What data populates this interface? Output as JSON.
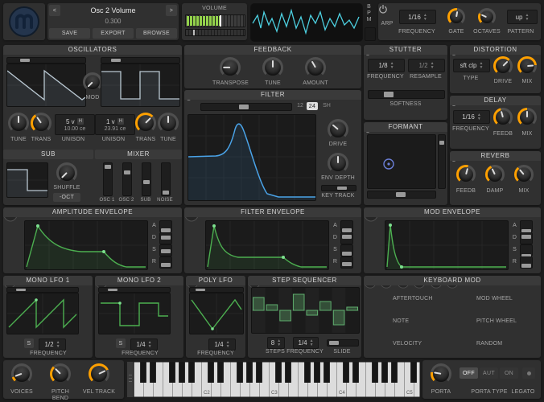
{
  "header": {
    "patch": {
      "prev": "<",
      "next": ">",
      "name": "Osc 2 Volume",
      "value": "0.300",
      "save": "SAVE",
      "export": "EXPORT",
      "browse": "BROWSE"
    },
    "volume_label": "VOLUME",
    "bpm_label": "BPM",
    "arp": {
      "title": "ARP",
      "freq_value": "1/16",
      "freq_label": "FREQUENCY",
      "gate_label": "GATE",
      "octaves_label": "OCTAVES",
      "pattern_value": "up",
      "pattern_label": "PATTERN"
    }
  },
  "osc": {
    "title": "OSCILLATORS",
    "mod_label": "MOD",
    "tune1_label": "TUNE",
    "trans1_label": "TRANS",
    "unison1_voices": "5 v",
    "unison1_h": "H",
    "unison1_cents": "10.00 ce",
    "unison1_label": "UNISON",
    "unison2_voices": "1 v",
    "unison2_h": "H",
    "unison2_cents": "23.91 ce",
    "unison2_label": "UNISON",
    "trans2_label": "TRANS",
    "tune2_label": "TUNE"
  },
  "sub": {
    "title": "SUB",
    "shuffle_label": "SHUFFLE",
    "oct_button": "-OCT"
  },
  "mixer": {
    "title": "MIXER",
    "ch1": "OSC 1",
    "ch2": "OSC 2",
    "ch3": "SUB",
    "ch4": "NOISE"
  },
  "feedback": {
    "title": "FEEDBACK",
    "transpose_label": "TRANSPOSE",
    "tune_label": "TUNE",
    "amount_label": "AMOUNT"
  },
  "filter": {
    "title": "FILTER",
    "db12": "12",
    "db24": "24",
    "sh": "SH",
    "drive_label": "DRIVE",
    "env_depth_label": "ENV DEPTH",
    "key_track_label": "KEY TRACK"
  },
  "stutter": {
    "title": "STUTTER",
    "freq_value": "1/8",
    "freq_label": "FREQUENCY",
    "resample_value": "1/2",
    "resample_label": "RESAMPLE",
    "softness_label": "SOFTNESS"
  },
  "formant": {
    "title": "FORMANT"
  },
  "distortion": {
    "title": "DISTORTION",
    "type_value": "sft clp",
    "type_label": "TYPE",
    "drive_label": "DRIVE",
    "mix_label": "MIX"
  },
  "delay": {
    "title": "DELAY",
    "freq_value": "1/16",
    "freq_label": "FREQUENCY",
    "feedb_label": "FEEDB",
    "mix_label": "MIX"
  },
  "reverb": {
    "title": "REVERB",
    "feedb_label": "FEEDB",
    "damp_label": "DAMP",
    "mix_label": "MIX"
  },
  "amp_env": {
    "title": "AMPLITUDE ENVELOPE",
    "a": "A",
    "d": "D",
    "s": "S",
    "r": "R"
  },
  "filter_env": {
    "title": "FILTER ENVELOPE",
    "a": "A",
    "d": "D",
    "s": "S",
    "r": "R"
  },
  "mod_env": {
    "title": "MOD ENVELOPE",
    "a": "A",
    "d": "D",
    "s": "S",
    "r": "R"
  },
  "lfo1": {
    "title": "MONO LFO 1",
    "sync": "S",
    "freq_value": "1/2",
    "freq_label": "FREQUENCY"
  },
  "lfo2": {
    "title": "MONO LFO 2",
    "sync": "S",
    "freq_value": "1/4",
    "freq_label": "FREQUENCY"
  },
  "polylfo": {
    "title": "POLY LFO",
    "freq_value": "1/4",
    "freq_label": "FREQUENCY"
  },
  "stepseq": {
    "title": "STEP SEQUENCER",
    "steps_value": "8",
    "steps_label": "STEPS",
    "freq_value": "1/4",
    "freq_label": "FREQUENCY",
    "slide_label": "SLIDE"
  },
  "kbmod": {
    "title": "KEYBOARD MOD",
    "items": [
      "AFTERTOUCH",
      "NOTE",
      "VELOCITY",
      "MOD WHEEL",
      "PITCH WHEEL",
      "RANDOM"
    ]
  },
  "bottom": {
    "voices_label": "VOICES",
    "pitch_bend_label": "PITCH BEND",
    "vel_track_label": "VEL TRACK",
    "kb_c2": "C2",
    "kb_c3": "C3",
    "kb_c4": "C4",
    "kb_c5": "C5",
    "porta_label": "PORTA",
    "off": "OFF",
    "aut": "AUT",
    "on": "ON",
    "porta_type_label": "PORTA TYPE",
    "legato_label": "LEGATO"
  }
}
